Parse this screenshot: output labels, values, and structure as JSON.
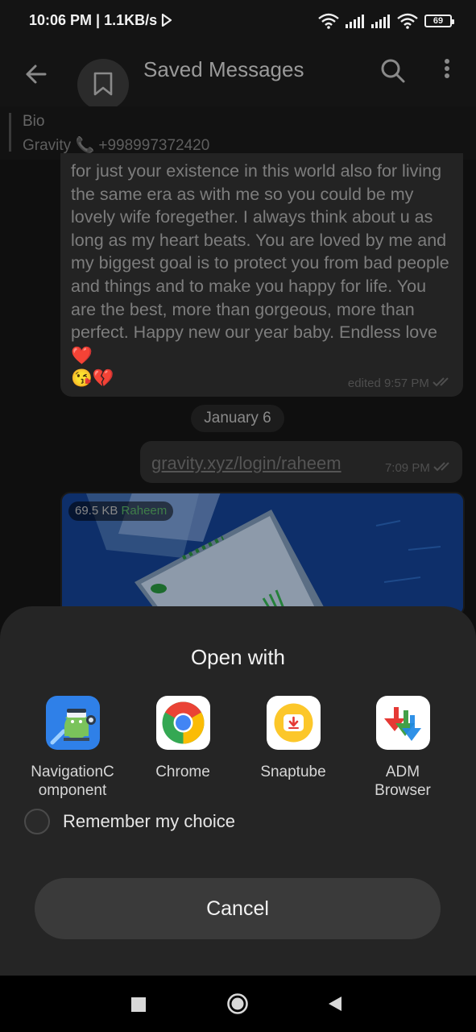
{
  "status_bar": {
    "time_speed": "10:06 PM | 1.1KB/s",
    "battery": "69"
  },
  "chat": {
    "title": "Saved Messages",
    "pinned": {
      "title": "Bio",
      "text": "Gravity 📞 +998997372420"
    },
    "message": {
      "text": "for just your existence in this world also for living the same era as with me so you could be my lovely wife foregether. I always think about u as long as my heart beats. You are loved by me and my biggest goal is to protect you from bad people and things and to make you happy for life. You are the best, more than gorgeous, more than perfect. Happy new our year baby. Endless love❤️",
      "emojis": "😘💔",
      "meta": "edited 9:57 PM"
    },
    "date_chip": "January 6",
    "link_message": {
      "text": "gravity.xyz/login/raheem",
      "time": "7:09 PM"
    },
    "image_message": {
      "size": "69.5 KB",
      "sender": "Raheem"
    }
  },
  "sheet": {
    "title": "Open with",
    "apps": [
      {
        "label": "NavigationC\nomponent",
        "icon": "android-navigation-icon"
      },
      {
        "label": "Chrome",
        "icon": "chrome-icon"
      },
      {
        "label": "Snaptube",
        "icon": "snaptube-icon"
      },
      {
        "label": "ADM\nBrowser",
        "icon": "adm-browser-icon"
      }
    ],
    "remember_label": "Remember my choice",
    "cancel_label": "Cancel"
  },
  "colors": {
    "sheet_bg": "#252525",
    "button_bg": "#3a3a3a",
    "chrome_red": "#ea4335",
    "chrome_green": "#34a853",
    "chrome_yellow": "#fbbc05",
    "chrome_blue": "#4285f4",
    "snaptube_yellow": "#fcc72a"
  }
}
